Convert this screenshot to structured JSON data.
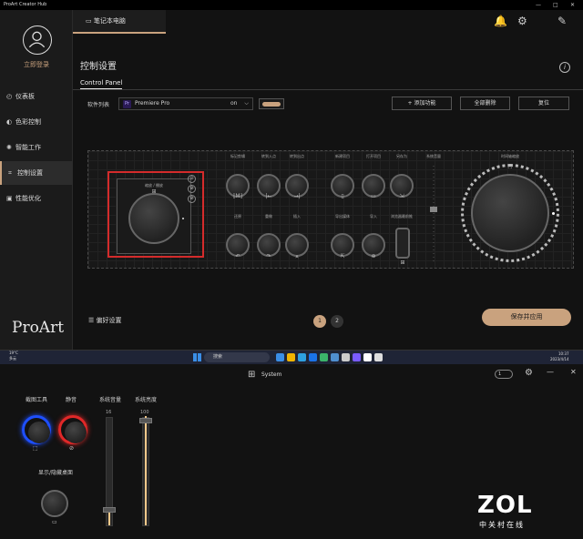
{
  "window": {
    "title": "ProArt Creator Hub",
    "minimize": "—",
    "maximize": "□",
    "close": "✕"
  },
  "sidebar": {
    "login": "立即登录",
    "items": [
      {
        "label": "仪表板",
        "icon": "dashboard-icon",
        "glyph": "◴"
      },
      {
        "label": "色彩控制",
        "icon": "color-icon",
        "glyph": "◐"
      },
      {
        "label": "智能工作",
        "icon": "smart-work-icon",
        "glyph": "✺"
      },
      {
        "label": "控制设置",
        "icon": "control-icon",
        "glyph": "⌗"
      },
      {
        "label": "性能优化",
        "icon": "performance-icon",
        "glyph": "▣"
      }
    ],
    "active_index": 3,
    "brand": "ProArt"
  },
  "header": {
    "device_tab": "笔记本电脑",
    "bell": "🔔",
    "gear": "⚙",
    "feedback": "✎"
  },
  "main": {
    "title": "控制设置",
    "info": "i",
    "tab": "Control Panel",
    "software_label": "软件列表",
    "app_badge": "Pr",
    "app_name": "Premiere Pro",
    "on_label": "on",
    "chevron": "⌵",
    "buttons": {
      "add": "+ 添加功能",
      "delete_all": "全部删除",
      "reset": "复位"
    }
  },
  "panel": {
    "dial_label": "缩放 / 播放",
    "dial_top_icon": "⊞",
    "side_icons": [
      "⊙",
      "⊘",
      "⊘"
    ],
    "row1": [
      {
        "label": "标记剪辑",
        "glyph": "⟦M⟧"
      },
      {
        "label": "转到入点",
        "glyph": "|←"
      },
      {
        "label": "转到出点",
        "glyph": "→|"
      },
      {
        "label": "新建项目",
        "glyph": "▯"
      },
      {
        "label": "打开项目",
        "glyph": "▭"
      },
      {
        "label": "另存为",
        "glyph": "⇲"
      }
    ],
    "row2": [
      {
        "label": "还原",
        "glyph": "↶"
      },
      {
        "label": "重做",
        "glyph": "↷"
      },
      {
        "label": "插入",
        "glyph": "⩓"
      },
      {
        "label": "导出媒体",
        "glyph": "⇱"
      },
      {
        "label": "导入",
        "glyph": "⊕"
      },
      {
        "label": "浏览器最前推",
        "glyph": "⊞"
      }
    ],
    "slider_label": "系统音量",
    "slider_level": 0.55,
    "big_label": "时间轴缩放",
    "big_icon": "⛶"
  },
  "footer": {
    "prefs_icon": "☰",
    "prefs": "偏好设置",
    "pages": [
      "1",
      "2"
    ],
    "active_page": 0,
    "save": "保存并应用"
  },
  "taskbar": {
    "weather_temp": "19°C",
    "weather_desc": "多云",
    "search": "搜索",
    "time": "10:37",
    "date": "2023/4/14",
    "app_colors": [
      "#3a8ee6",
      "#f0b400",
      "#2ea0e0",
      "#1a73e8",
      "#3bb36a",
      "#4f8fd0",
      "#cccccc",
      "#7a5cff",
      "#ffffff",
      "#dddddd"
    ]
  },
  "system_panel": {
    "title": "System",
    "grid_icon": "⊞",
    "toggle_num": "1",
    "labels": {
      "tool": "截图工具",
      "mute": "静音",
      "volume": "系统音量",
      "brightness": "系统亮度",
      "desktop": "显示/隐藏桌面"
    },
    "glyphs": {
      "tool": "⬚",
      "mute": "⊘",
      "desktop": "▭"
    },
    "volume_value": "16",
    "brightness_value": "100",
    "volume_level": 0.16,
    "brightness_level": 1.0,
    "tool_color": "#1e4fff",
    "mute_color": "#e02828"
  },
  "watermark": {
    "logo": "ZOL",
    "sub": "中关村在线"
  }
}
